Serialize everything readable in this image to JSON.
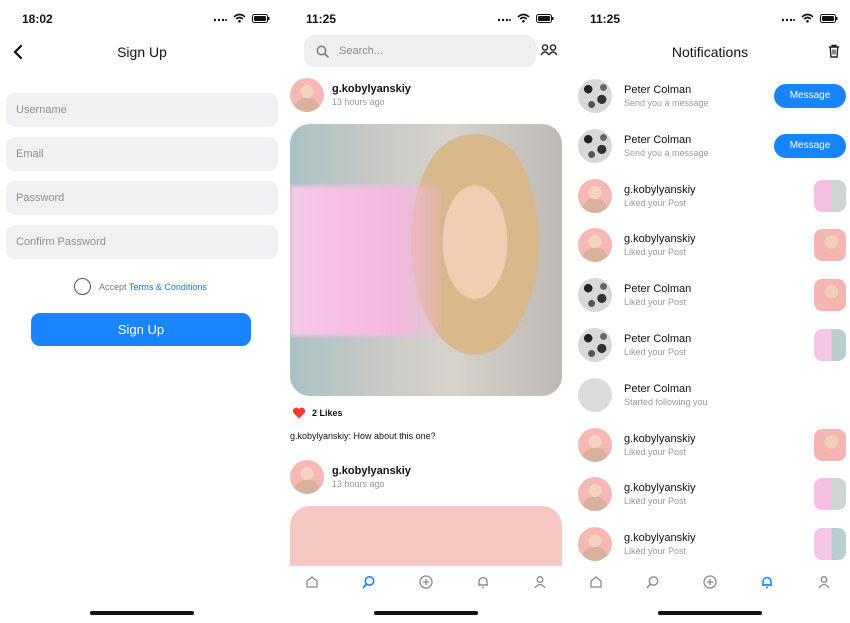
{
  "signup": {
    "time": "18:02",
    "title": "Sign Up",
    "fields": [
      "Username",
      "Email",
      "Password",
      "Confirm Password"
    ],
    "accept_text": "Accept",
    "terms_link": "Terms & Conditions",
    "button": "Sign Up"
  },
  "feed": {
    "time": "11:25",
    "search_placeholder": "Search...",
    "post1": {
      "user": "g.kobylyanskiy",
      "ago": "13 hours ago"
    },
    "likes": "2 Likes",
    "caption_user": "g.kobylyanskiy:",
    "caption_text": "How about this one?",
    "post2": {
      "user": "g.kobylyanskiy",
      "ago": "13 hours ago"
    },
    "active_tab": "search"
  },
  "notifications": {
    "time": "11:25",
    "title": "Notifications",
    "items": [
      {
        "name": "Peter Colman",
        "sub": "Send you a message",
        "avatar": "bw",
        "action": "Message"
      },
      {
        "name": "Peter Colman",
        "sub": "Send you a message",
        "avatar": "bw",
        "action": "Message"
      },
      {
        "name": "g.kobylyanskiy",
        "sub": "Liked your Post",
        "avatar": "pink",
        "thumb": "a"
      },
      {
        "name": "g.kobylyanskiy",
        "sub": "Liked your Post",
        "avatar": "pink",
        "thumb": "b"
      },
      {
        "name": "Peter Colman",
        "sub": "Liked your Post",
        "avatar": "bw",
        "thumb": "b"
      },
      {
        "name": "Peter Colman",
        "sub": "Liked your Post",
        "avatar": "bw",
        "thumb": "c"
      },
      {
        "name": "Peter Colman",
        "sub": "Started following you",
        "avatar": "grey"
      },
      {
        "name": "g.kobylyanskiy",
        "sub": "Liked your Post",
        "avatar": "pink",
        "thumb": "b"
      },
      {
        "name": "g.kobylyanskiy",
        "sub": "Liked your Post",
        "avatar": "pink",
        "thumb": "a"
      },
      {
        "name": "g.kobylyanskiy",
        "sub": "Liked your Post",
        "avatar": "pink",
        "thumb": "c"
      }
    ],
    "active_tab": "notifications"
  },
  "colors": {
    "accent": "#1a84ff",
    "heart": "#ff3b30"
  }
}
